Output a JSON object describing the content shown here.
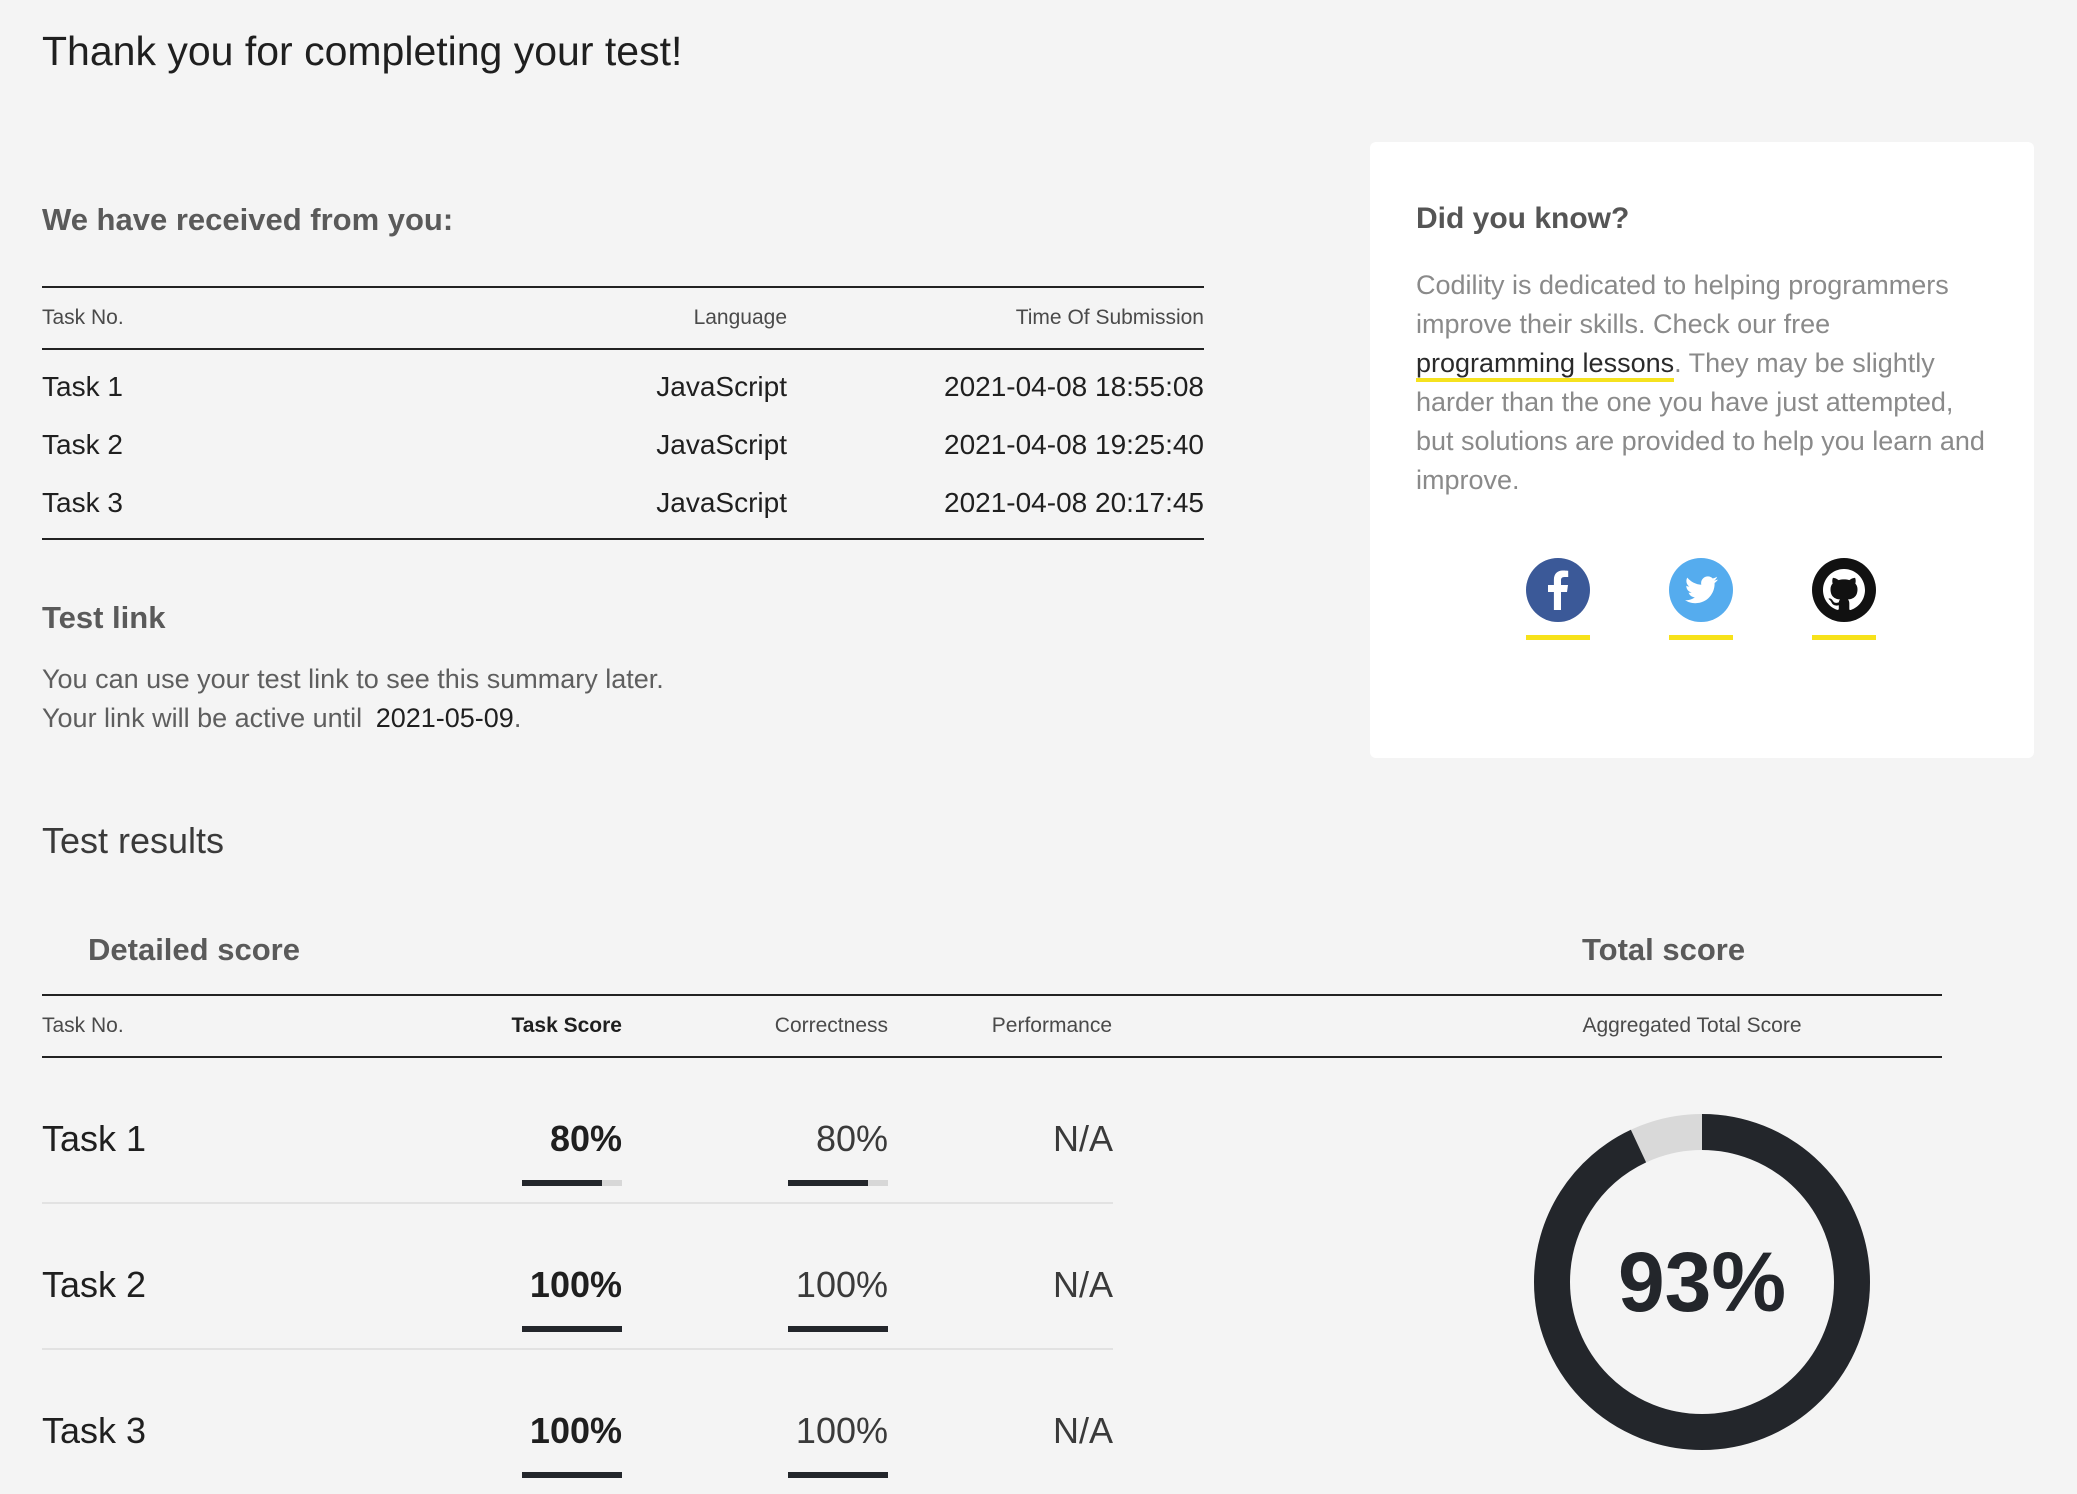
{
  "page_title": "Thank you for completing your test!",
  "received": {
    "heading": "We have received from you:",
    "columns": {
      "task": "Task No.",
      "language": "Language",
      "time": "Time Of Submission"
    },
    "rows": [
      {
        "task": "Task 1",
        "language": "JavaScript",
        "time": "2021-04-08 18:55:08"
      },
      {
        "task": "Task 2",
        "language": "JavaScript",
        "time": "2021-04-08 19:25:40"
      },
      {
        "task": "Task 3",
        "language": "JavaScript",
        "time": "2021-04-08 20:17:45"
      }
    ]
  },
  "test_link": {
    "heading": "Test link",
    "line1": "You can use your test link to see this summary later.",
    "line2_prefix": "Your link will be active until",
    "active_until": "2021-05-09",
    "line2_suffix": "."
  },
  "did_you_know": {
    "heading": "Did you know?",
    "text_before": "Codility is dedicated to helping programmers improve their skills. Check our free ",
    "link_text": "programming lessons",
    "text_after": ". They may be slightly harder than the one you have just attempted, but solutions are provided to help you learn and improve.",
    "social": [
      {
        "icon": "facebook-icon",
        "color": "#3b5998"
      },
      {
        "icon": "twitter-icon",
        "color": "#55acee"
      },
      {
        "icon": "github-icon",
        "color": "#111111"
      }
    ],
    "accent_color": "#f5e21f"
  },
  "results": {
    "heading": "Test results",
    "detailed_heading": "Detailed score",
    "total_heading": "Total score",
    "columns": {
      "task": "Task No.",
      "task_score": "Task Score",
      "correctness": "Correctness",
      "performance": "Performance",
      "aggregated": "Aggregated Total Score"
    },
    "rows": [
      {
        "task": "Task 1",
        "task_score": "80%",
        "task_score_value": 0.8,
        "correctness": "80%",
        "correctness_value": 0.8,
        "performance": "N/A"
      },
      {
        "task": "Task 2",
        "task_score": "100%",
        "task_score_value": 1.0,
        "correctness": "100%",
        "correctness_value": 1.0,
        "performance": "N/A"
      },
      {
        "task": "Task 3",
        "task_score": "100%",
        "task_score_value": 1.0,
        "correctness": "100%",
        "correctness_value": 1.0,
        "performance": "N/A"
      }
    ],
    "total_score": "93%",
    "total_score_value": 0.93,
    "donut_color": "#23262b",
    "donut_track_color": "#d9d9d9"
  }
}
